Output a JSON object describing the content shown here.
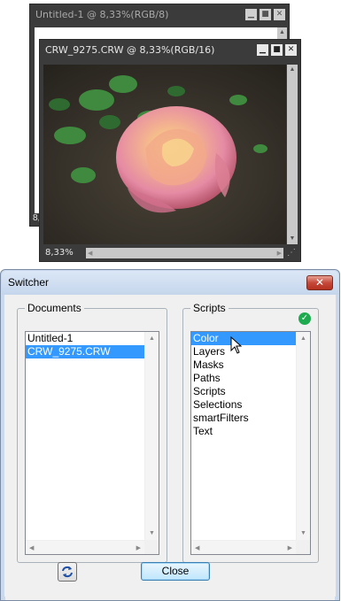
{
  "window_back": {
    "title": "Untitled-1 @ 8,33%(RGB/8)",
    "zoom": "8,3",
    "controls": [
      "minimize-icon",
      "maximize-icon",
      "close-icon"
    ]
  },
  "window_front": {
    "title": "CRW_9275.CRW @ 8,33%(RGB/16)",
    "zoom": "8,33%",
    "controls": [
      "minimize-icon",
      "maximize-icon",
      "close-icon"
    ]
  },
  "dialog": {
    "title": "Switcher",
    "close_glyph": "✕",
    "documents": {
      "legend": "Documents",
      "items": [
        "Untitled-1",
        "CRW_9275.CRW"
      ],
      "selected_index": 1
    },
    "scripts": {
      "legend": "Scripts",
      "items": [
        "Color",
        "Layers",
        "Masks",
        "Paths",
        "Scripts",
        "Selections",
        "smartFilters",
        "Text"
      ],
      "selected_index": 0,
      "status_icon": "check-circle-icon"
    },
    "refresh_icon": "refresh-icon",
    "close_button": "Close"
  },
  "colors": {
    "selection": "#3399ff",
    "ps_window_bg": "#3b3b3b",
    "status_ok": "#1eaa4f"
  }
}
